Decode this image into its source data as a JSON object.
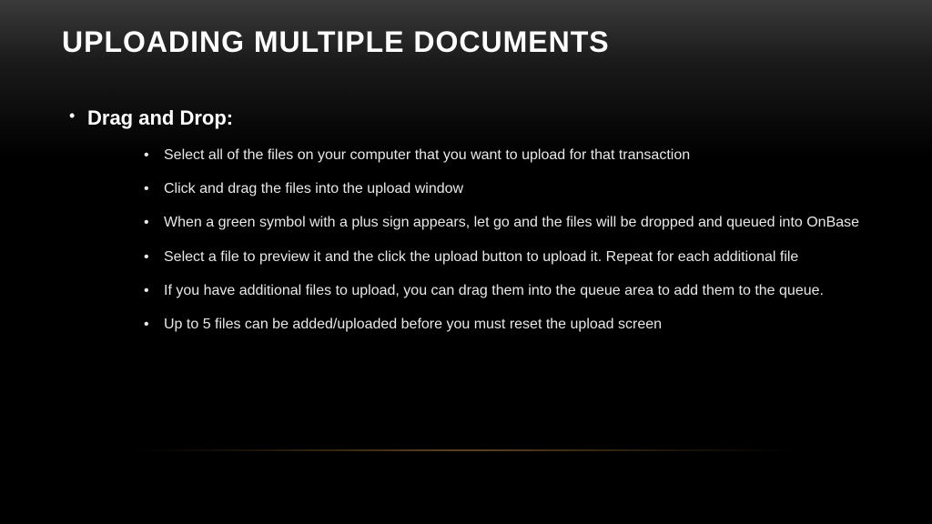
{
  "slide": {
    "title": "UPLOADING MULTIPLE DOCUMENTS",
    "mainBullet": "Drag and Drop:",
    "subBullets": [
      "Select all of the files on your computer that you want to upload for that transaction",
      "Click and drag the files into the upload window",
      "When a green symbol with a plus sign appears, let go and the files will be dropped and queued into OnBase",
      "Select a file to preview it and the click the upload button to upload it. Repeat for each additional file",
      "If you have additional files to upload, you can drag them into the queue area to add them to the queue.",
      "Up to 5 files can be added/uploaded before you must reset the upload screen"
    ]
  }
}
